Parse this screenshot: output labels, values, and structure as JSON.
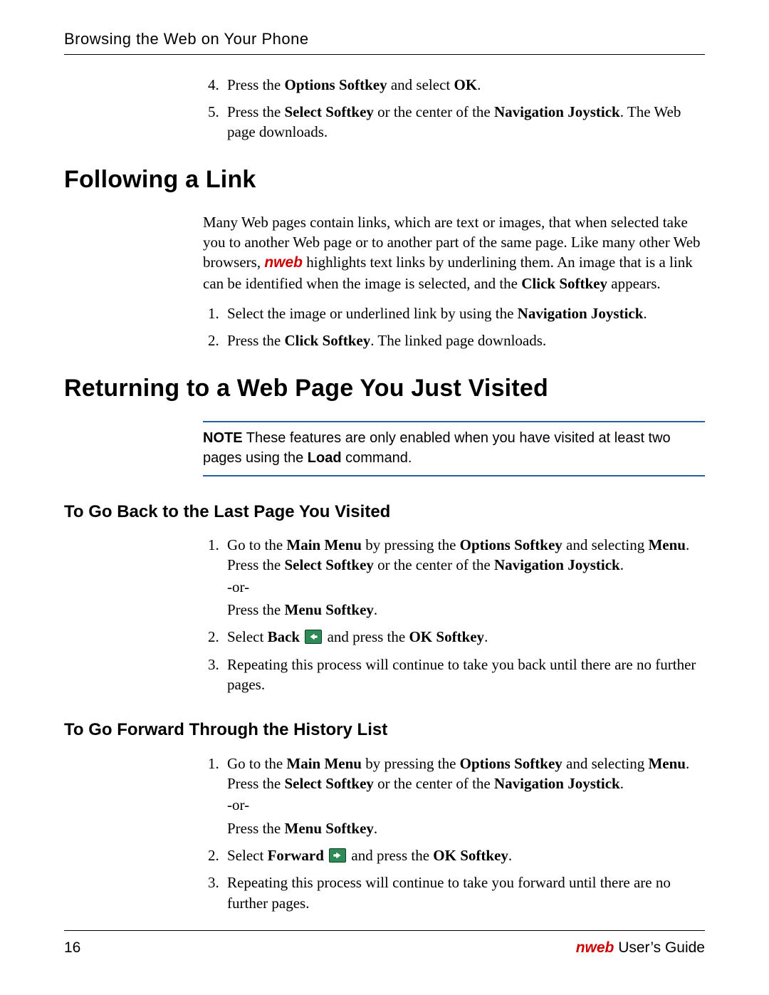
{
  "runningHead": "Browsing the Web on Your Phone",
  "introSteps": {
    "startNumber": 4,
    "items": [
      {
        "pre": "Press the ",
        "b1": "Options Softkey",
        "mid": " and select ",
        "b2": "OK",
        "post": "."
      },
      {
        "pre": "Press the ",
        "b1": "Select Softkey",
        "mid": " or the center of the ",
        "b2": "Navigation Joystick",
        "post": ". The Web page downloads."
      }
    ]
  },
  "section1": {
    "title": "Following a Link",
    "paragraph": {
      "p1": "Many Web pages contain links, which are text or images, that when selected take you to another Web page or to another part of the same page. Like many other Web browsers, ",
      "brand": "nweb",
      "p2": " highlights text links by underlining them. An image that is a link can be identified when the image is selected, and the ",
      "b1": "Click Softkey",
      "p3": " appears."
    },
    "steps": [
      {
        "pre": "Select the image or underlined link by using the ",
        "b1": "Navigation Joystick",
        "post": "."
      },
      {
        "pre": "Press the ",
        "b1": "Click Softkey",
        "post": ". The linked page downloads."
      }
    ]
  },
  "section2": {
    "title": "Returning to a Web Page You Just Visited",
    "note": {
      "label": "NOTE",
      "t1": "  These features are only enabled when you have visited at least two pages using the ",
      "b1": "Load",
      "t2": " command."
    },
    "sub1": {
      "title": "To Go Back to the Last Page You Visited",
      "step1": {
        "a": "Go to the ",
        "b1": "Main Menu",
        "c": " by pressing the ",
        "b2": "Options Softkey",
        "d": " and selecting ",
        "b3": "Menu",
        "e": ". Press the ",
        "b4": "Select Softkey",
        "f": " or the center of the ",
        "b5": "Navigation Joystick",
        "g": ".",
        "or": "-or-",
        "h": "Press the ",
        "b6": "Menu Softkey",
        "i": "."
      },
      "step2": {
        "a": "Select ",
        "b1": "Back",
        "c": " and press the ",
        "b2": "OK Softkey",
        "d": "."
      },
      "step3": "Repeating this process will continue to take you back until there are no further pages."
    },
    "sub2": {
      "title": "To Go Forward Through the History List",
      "step1": {
        "a": "Go to the ",
        "b1": "Main Menu",
        "c": " by pressing the ",
        "b2": "Options Softkey",
        "d": " and selecting ",
        "b3": "Menu",
        "e": ". Press the ",
        "b4": "Select Softkey",
        "f": " or the center of the ",
        "b5": "Navigation Joystick",
        "g": ".",
        "or": "-or-",
        "h": "Press the ",
        "b6": "Menu Softkey",
        "i": "."
      },
      "step2": {
        "a": "Select ",
        "b1": "Forward",
        "c": " and press the ",
        "b2": "OK Softkey",
        "d": "."
      },
      "step3": "Repeating this process will continue to take you forward until there are no further pages."
    }
  },
  "footer": {
    "pageNumber": "16",
    "brand": "nweb",
    "guide": " User’s Guide"
  }
}
